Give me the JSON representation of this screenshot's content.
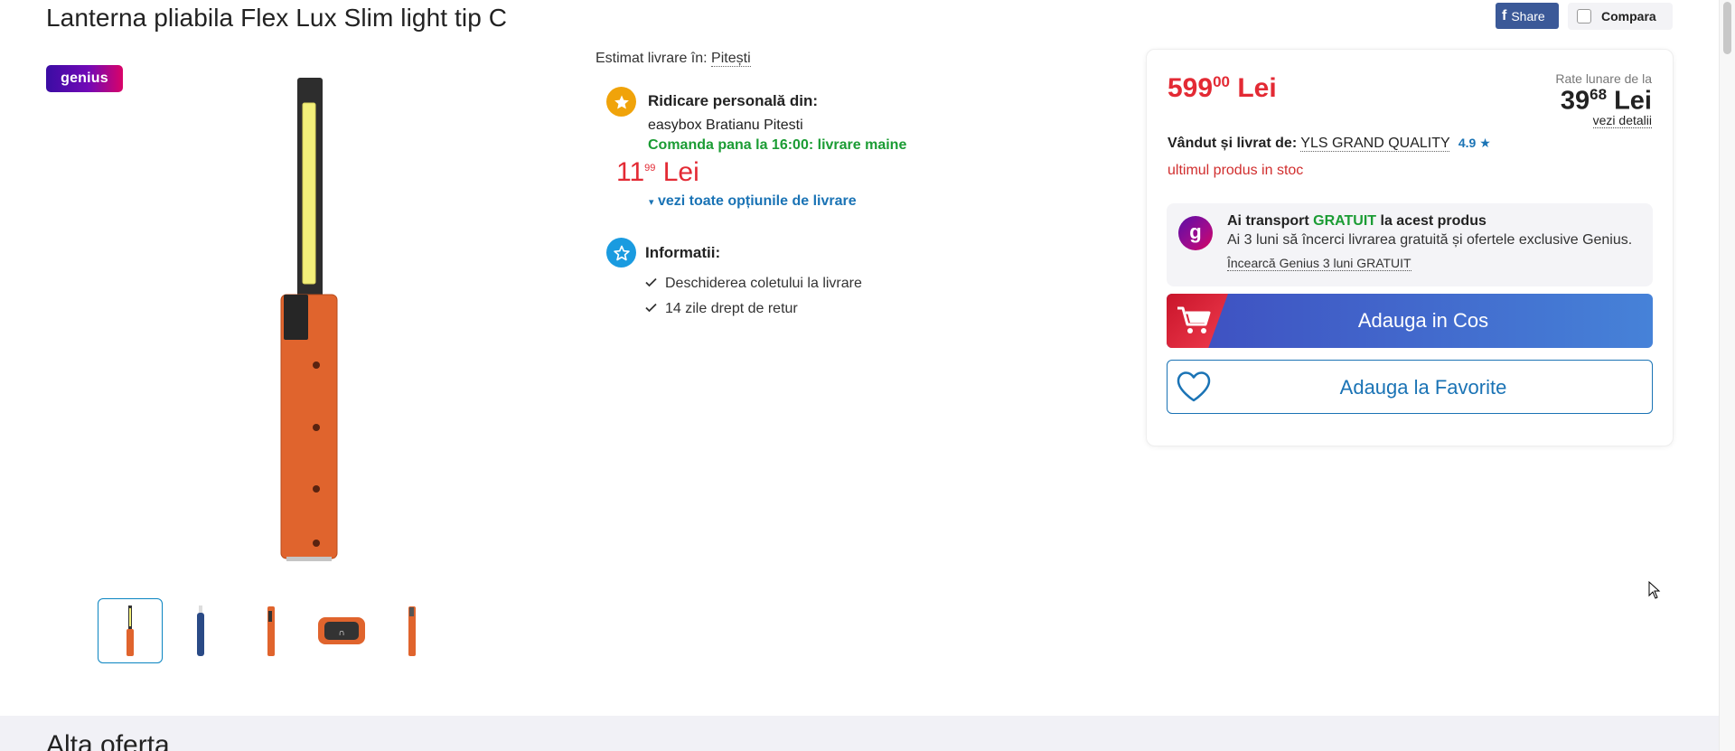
{
  "product": {
    "title": "Lanterna pliabila Flex Lux Slim light tip C",
    "share_label": "Share",
    "compare_label": "Compara",
    "genius_badge": "genius",
    "thumbnails": [
      "flashlight-orange",
      "flashlight-blue",
      "flashlight-orange-side",
      "flashlight-clip",
      "flashlight-orange-slim"
    ]
  },
  "delivery": {
    "estimate_label": "Estimat livrare în:",
    "location": "Pitești",
    "pickup_title": "Ridicare personală din:",
    "pickup_location": "easybox Bratianu Pitesti",
    "pickup_deadline": "Comanda pana la 16:00: livrare maine",
    "pickup_price_int": "11",
    "pickup_price_dec": "99",
    "pickup_currency": "Lei",
    "more_options": "vezi toate opțiunile de livrare",
    "info_title": "Informatii:",
    "info_items": [
      "Deschiderea coletului la livrare",
      "14 zile drept de retur"
    ]
  },
  "buy": {
    "price_int": "599",
    "price_dec": "00",
    "currency": "Lei",
    "rate_label": "Rate lunare de la",
    "rate_int": "39",
    "rate_dec": "68",
    "rate_link": "vezi detalii",
    "seller_label": "Vândut și livrat de:",
    "seller_name": "YLS GRAND QUALITY",
    "seller_rating": "4.9",
    "stock": "ultimul produs in stoc",
    "genius_title_pre": "Ai transport",
    "genius_title_free": "GRATUIT",
    "genius_title_post": "la acest produs",
    "genius_desc": "Ai 3 luni să încerci livrarea gratuită și ofertele exclusive Genius.",
    "genius_link": "Încearcă Genius 3 luni GRATUIT",
    "genius_logo": "g",
    "cart_label": "Adauga in Cos",
    "fav_label": "Adauga la Favorite"
  },
  "bottom": {
    "heading": "Alta oferta"
  },
  "colors": {
    "price_red": "#e32a34",
    "link_blue": "#1a73b5",
    "green": "#1b9c34",
    "facebook": "#3b5998"
  }
}
